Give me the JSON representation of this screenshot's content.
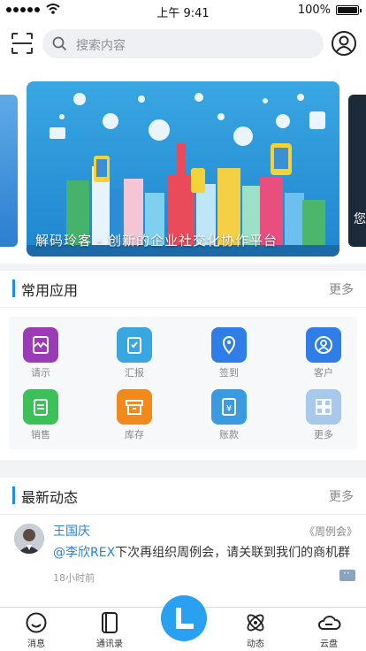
{
  "status_bar": {
    "time": "上午 9:41",
    "battery": "100%"
  },
  "search": {
    "placeholder": "搜索内容"
  },
  "banner": {
    "caption": "解码玲客 - 创新的企业社交化协作平台",
    "peek_right_text": "您"
  },
  "apps_section": {
    "title": "常用应用",
    "more": "更多",
    "items": [
      {
        "label": "请示",
        "icon": "request-icon",
        "color": "#9b3bb8"
      },
      {
        "label": "汇报",
        "icon": "report-icon",
        "color": "#3aa6e0"
      },
      {
        "label": "签到",
        "icon": "location-icon",
        "color": "#2f7ee8"
      },
      {
        "label": "客户",
        "icon": "customer-icon",
        "color": "#2f7ee8"
      },
      {
        "label": "销售",
        "icon": "sales-icon",
        "color": "#3cc05a"
      },
      {
        "label": "库存",
        "icon": "inventory-icon",
        "color": "#f08a1c"
      },
      {
        "label": "账款",
        "icon": "payment-icon",
        "color": "#3a9be0"
      },
      {
        "label": "更多",
        "icon": "grid-icon",
        "color": "#a8c8ec"
      }
    ]
  },
  "news_section": {
    "title": "最新动态",
    "more": "更多",
    "items": [
      {
        "name": "王国庆",
        "tag": "《周例会》",
        "mention": "@李欣REX",
        "content": "下次再组织周例会，请关联到我们的商机群",
        "time": "18小时前"
      }
    ]
  },
  "tabbar": {
    "tabs": [
      {
        "label": "消息",
        "icon": "message-icon"
      },
      {
        "label": "通讯录",
        "icon": "contacts-icon"
      },
      {
        "label": "动态",
        "icon": "activity-icon"
      },
      {
        "label": "云盘",
        "icon": "cloud-icon"
      }
    ],
    "center_icon": "home-logo-icon"
  }
}
